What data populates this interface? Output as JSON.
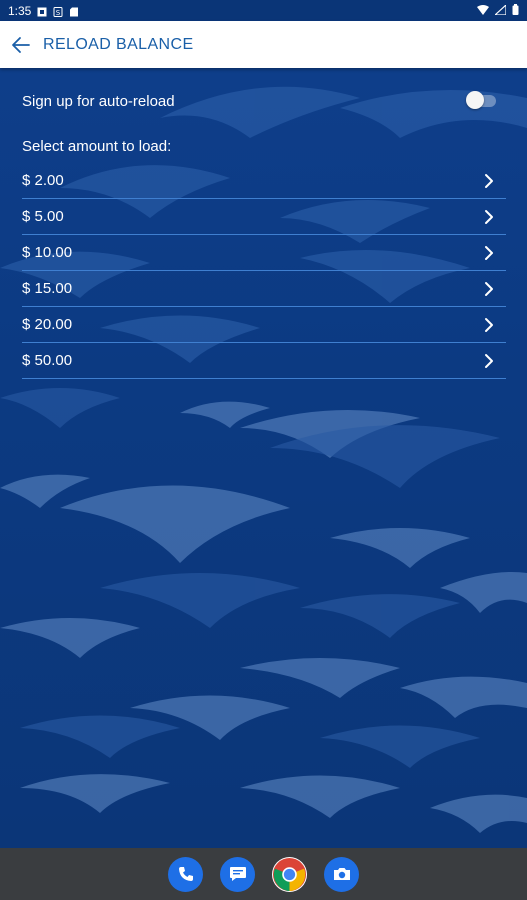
{
  "status_bar": {
    "time": "1:35"
  },
  "app_bar": {
    "title": "RELOAD BALANCE"
  },
  "auto_reload": {
    "label": "Sign up for auto-reload",
    "enabled": false
  },
  "select_label": "Select amount to load:",
  "amounts": [
    {
      "label": "$ 2.00"
    },
    {
      "label": "$ 5.00"
    },
    {
      "label": "$ 10.00"
    },
    {
      "label": "$ 15.00"
    },
    {
      "label": "$ 20.00"
    },
    {
      "label": "$ 50.00"
    }
  ],
  "colors": {
    "accent": "#1a5fa8",
    "background": "#0d3c86",
    "divider": "#3f7fd0"
  },
  "dock": [
    "phone-icon",
    "messages-icon",
    "chrome-icon",
    "camera-icon"
  ]
}
